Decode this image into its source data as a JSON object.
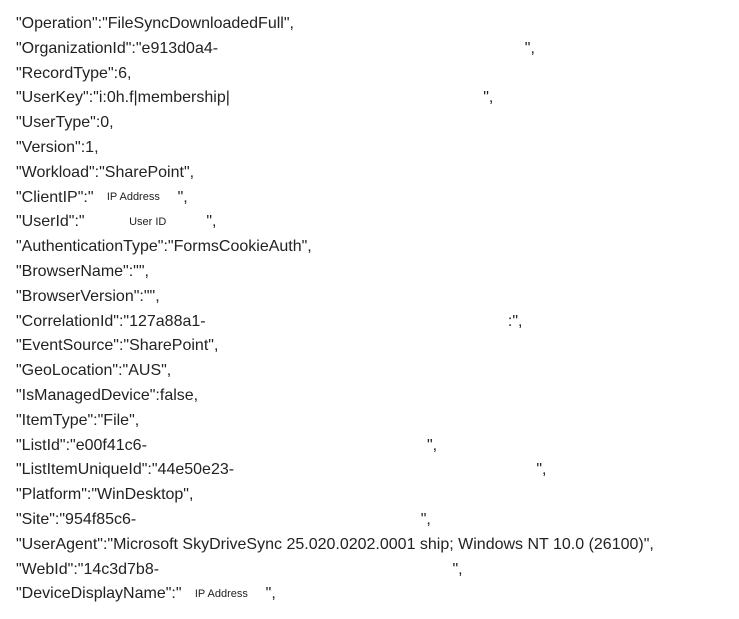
{
  "lines": [
    {
      "key": "Operation",
      "value": "FileSyncDownloadedFull",
      "trailComma": true
    },
    {
      "key": "OrganizationId",
      "value": "e913d0a4-",
      "trailSpaces": 69,
      "trailComma": true
    },
    {
      "key": "RecordType",
      "raw": "6",
      "trailComma": true
    },
    {
      "key": "UserKey",
      "value": "i:0h.f|membership|",
      "trailSpaces": 57,
      "trailComma": true
    },
    {
      "key": "UserType",
      "raw": "0",
      "trailComma": true
    },
    {
      "key": "Version",
      "raw": "1",
      "trailComma": true
    },
    {
      "key": "Workload",
      "value": "SharePoint",
      "trailComma": true
    },
    {
      "key": "ClientIP",
      "value": "",
      "placeholder": "IP Address",
      "trailComma": true
    },
    {
      "key": "UserId",
      "value": "",
      "placeholder": "User ID",
      "placeholderWide": true,
      "trailComma": true
    },
    {
      "key": "AuthenticationType",
      "value": "FormsCookieAuth",
      "trailComma": true
    },
    {
      "key": "BrowserName",
      "value": "",
      "trailComma": true
    },
    {
      "key": "BrowserVersion",
      "value": "",
      "trailComma": true
    },
    {
      "key": "CorrelationId",
      "value": "127a88a1-",
      "trailSpaces": 68,
      "preClose": ":",
      "trailComma": true
    },
    {
      "key": "EventSource",
      "value": "SharePoint",
      "trailComma": true
    },
    {
      "key": "GeoLocation",
      "value": "AUS",
      "trailComma": true
    },
    {
      "key": "IsManagedDevice",
      "raw": "false",
      "trailComma": true
    },
    {
      "key": "ItemType",
      "value": "File",
      "trailComma": true
    },
    {
      "key": "ListId",
      "value": "e00f41c6-",
      "trailSpaces": 63,
      "trailComma": true
    },
    {
      "key": "ListItemUniqueId",
      "value": "44e50e23-",
      "trailSpaces": 68,
      "trailComma": true
    },
    {
      "key": "Platform",
      "value": "WinDesktop",
      "trailComma": true
    },
    {
      "key": "Site",
      "value": "954f85c6-",
      "trailSpaces": 64,
      "trailComma": true
    },
    {
      "key": "UserAgent",
      "value": "Microsoft SkyDriveSync 25.020.0202.0001 ship; Windows NT 10.0 (26100)",
      "trailComma": true
    },
    {
      "key": "WebId",
      "value": "14c3d7b8-",
      "trailSpaces": 66,
      "trailComma": true
    },
    {
      "key": "DeviceDisplayName",
      "value": "",
      "placeholder": "IP Address",
      "trailComma": true
    }
  ]
}
